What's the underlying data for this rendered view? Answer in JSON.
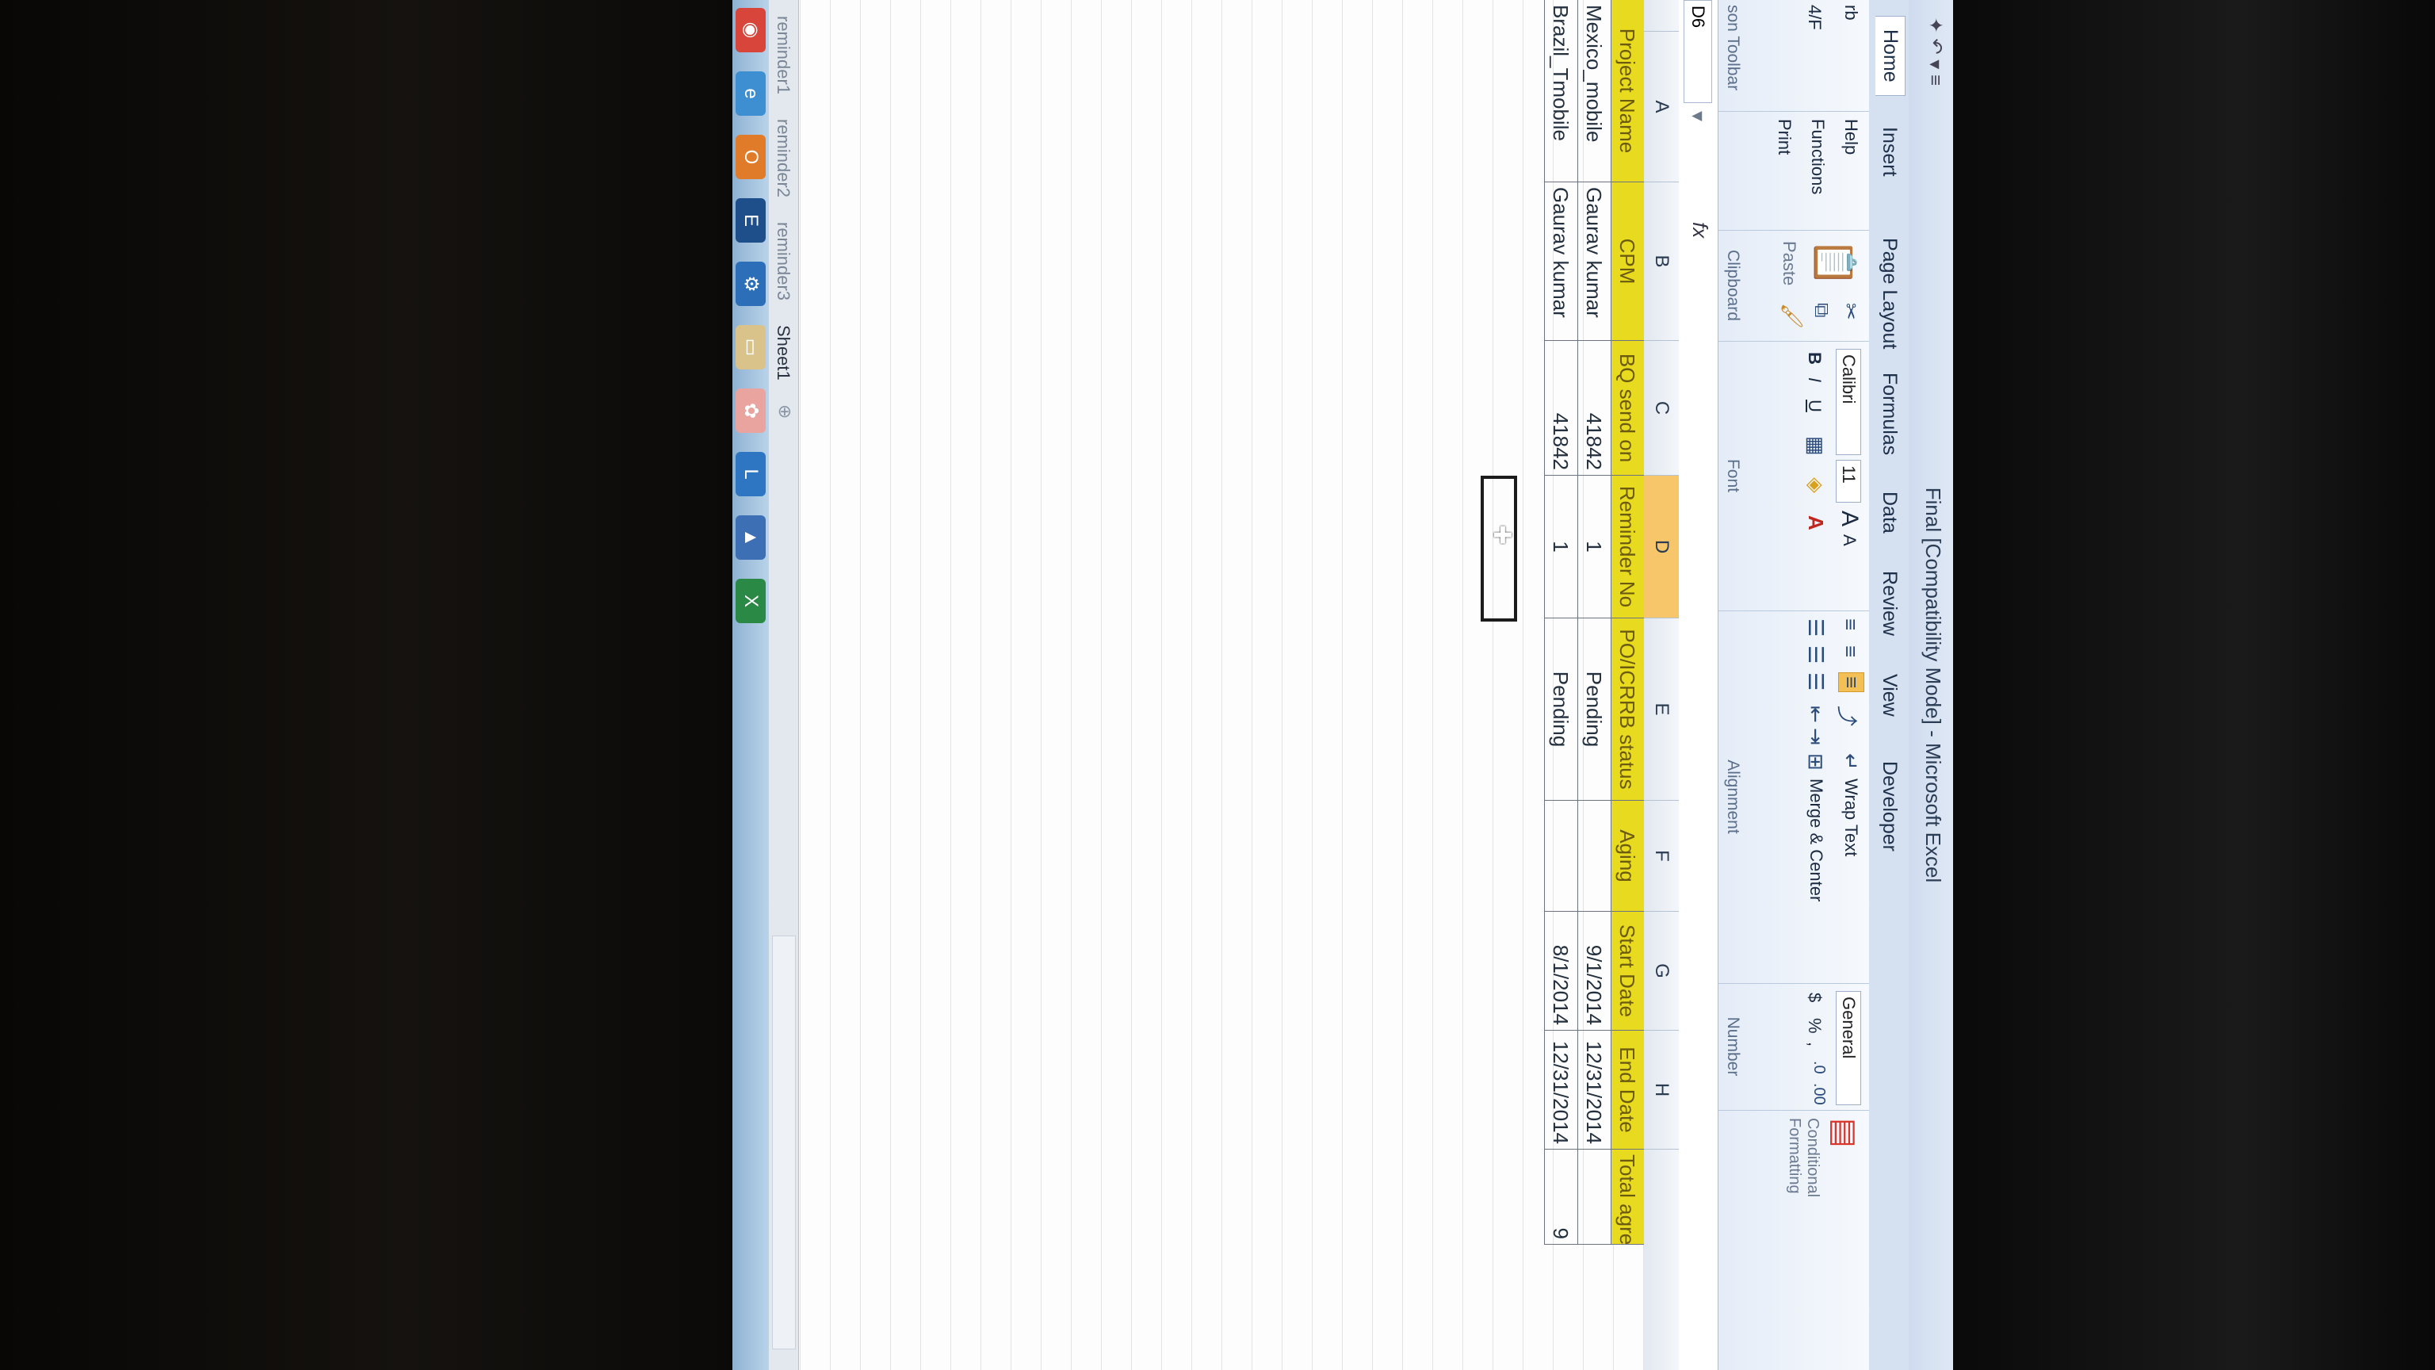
{
  "window": {
    "title": "Final [Compatibility Mode] - Microsoft Excel"
  },
  "tabs": [
    "Home",
    "Insert",
    "Page Layout",
    "Formulas",
    "Data",
    "Review",
    "View",
    "Developer"
  ],
  "toolbar_left": {
    "items": [
      "Help",
      "Functions",
      "Print"
    ],
    "group": "son Toolbar",
    "edge_top": "rb",
    "edge_mid": "4/F"
  },
  "clipboard": {
    "paste": "Paste",
    "group": "Clipboard"
  },
  "font": {
    "name": "Calibri",
    "size": "11",
    "bold": "B",
    "italic": "I",
    "underline": "U",
    "group": "Font",
    "grow": "A",
    "shrink": "A"
  },
  "alignment": {
    "wrap_text": "Wrap Text",
    "merge_center": "Merge & Center",
    "group": "Alignment"
  },
  "number": {
    "format": "General",
    "currency": "$",
    "percent": "%",
    "comma": ",",
    "group": "Number"
  },
  "styles": {
    "label": "Conditional Formatting"
  },
  "formula_bar": {
    "name_box": "D6",
    "fx": "fx",
    "value": ""
  },
  "columns": [
    "A",
    "B",
    "C",
    "D",
    "E",
    "F",
    "G",
    "H"
  ],
  "table": {
    "headers": [
      "Project Name",
      "CPM",
      "BQ send on",
      "Reminder No",
      "PO/ICRRB status",
      "Aging",
      "Start Date",
      "End Date",
      "Total agreed"
    ],
    "rows": [
      [
        "Mexico_mobile",
        "Gaurav kumar",
        "41842",
        "1",
        "Pending",
        "",
        "9/1/2014",
        "12/31/2014",
        ""
      ],
      [
        "Brazil_Tmobile",
        "Gaurav kumar",
        "41842",
        "1",
        "Pending",
        "",
        "8/1/2014",
        "12/31/2014",
        "9"
      ]
    ]
  },
  "sheets": [
    "reminder1",
    "reminder2",
    "reminder3",
    "Sheet1"
  ],
  "active_sheet": "Sheet1",
  "taskbar": [
    "chrome-icon",
    "ie-icon",
    "outlook-icon",
    "e-icon",
    "network-icon",
    "folder-icon",
    "paint-icon",
    "lync-icon",
    "app-icon",
    "excel-icon"
  ]
}
